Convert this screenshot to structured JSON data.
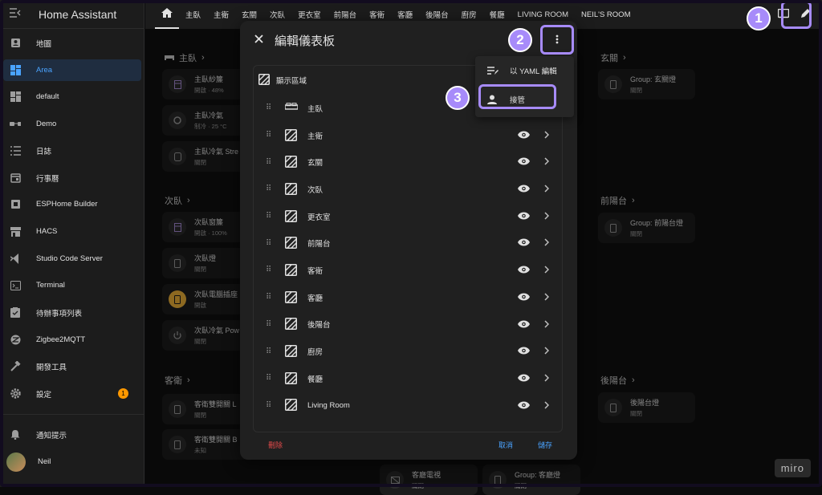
{
  "app": {
    "title": "Home Assistant"
  },
  "sidebar": {
    "items": [
      {
        "label": "地圖",
        "icon": "account-box-icon"
      },
      {
        "label": "Area",
        "icon": "dashboard-icon",
        "active": true
      },
      {
        "label": "default",
        "icon": "dashboard-icon"
      },
      {
        "label": "Demo",
        "icon": "glasses-icon"
      },
      {
        "label": "日誌",
        "icon": "list-icon"
      },
      {
        "label": "行事曆",
        "icon": "calendar-icon"
      },
      {
        "label": "ESPHome Builder",
        "icon": "chip-icon"
      },
      {
        "label": "HACS",
        "icon": "store-icon"
      },
      {
        "label": "Studio Code Server",
        "icon": "vscode-icon"
      },
      {
        "label": "Terminal",
        "icon": "terminal-icon"
      },
      {
        "label": "待辦事項列表",
        "icon": "clipboard-icon"
      },
      {
        "label": "Zigbee2MQTT",
        "icon": "zigbee-icon"
      },
      {
        "label": "開發工具",
        "icon": "hammer-icon"
      },
      {
        "label": "設定",
        "icon": "gear-icon",
        "badge": "1"
      }
    ],
    "notifications": "通知提示",
    "user": "Neil"
  },
  "topbar": {
    "tabs": [
      "主臥",
      "主衛",
      "玄關",
      "次臥",
      "更衣室",
      "前陽台",
      "客衛",
      "客廳",
      "後陽台",
      "廚房",
      "餐廳",
      "LIVING ROOM",
      "NEIL'S ROOM"
    ]
  },
  "main": {
    "sections": [
      {
        "title": "主臥"
      },
      {
        "title": "次臥"
      },
      {
        "title": "客衛"
      },
      {
        "title": "玄關"
      },
      {
        "title": "前陽台"
      },
      {
        "title": "後陽台"
      }
    ],
    "cards": [
      {
        "name": "主臥紗簾",
        "state": "開啟 · 48%"
      },
      {
        "name": "主臥冷氣",
        "state": "制冷 · 25 °C"
      },
      {
        "name": "主臥冷氣 Stre",
        "state": "關閉"
      },
      {
        "name": "次臥窗簾",
        "state": "開啟 · 100%"
      },
      {
        "name": "次臥燈",
        "state": "關閉"
      },
      {
        "name": "次臥電腦插座",
        "state": "開啟"
      },
      {
        "name": "次臥冷氣 Pow",
        "state": "關閉"
      },
      {
        "name": "客衛雙開關 L",
        "state": "關閉"
      },
      {
        "name": "客衛雙開關 B",
        "state": "未知"
      },
      {
        "name": "Group: 玄關燈",
        "state": "關閉"
      },
      {
        "name": "Group: 前陽台燈",
        "state": "關閉"
      },
      {
        "name": "後陽台燈",
        "state": "關閉"
      },
      {
        "name": "客廳電視",
        "state": "關閉"
      },
      {
        "name": "Group: 客廳燈",
        "state": "關閉"
      }
    ]
  },
  "dialog": {
    "title": "編輯儀表板",
    "show_areas": "顯示區域",
    "areas": [
      "主臥",
      "主衛",
      "玄關",
      "次臥",
      "更衣室",
      "前陽台",
      "客衛",
      "客廳",
      "後陽台",
      "廚房",
      "餐廳",
      "Living Room"
    ],
    "delete": "刪除",
    "cancel": "取消",
    "save": "儲存"
  },
  "menu": {
    "items": [
      {
        "label": "以 YAML 編輯",
        "icon": "edit-list-icon"
      },
      {
        "label": "接管",
        "icon": "account-icon"
      }
    ]
  },
  "annotations": {
    "step1": "1",
    "step2": "2",
    "step3": "3",
    "watermark": "miro"
  },
  "colors": {
    "accent": "#4aa3ff",
    "highlight": "#a78bfa",
    "danger": "#e34a4a",
    "badge": "#ff9800"
  }
}
